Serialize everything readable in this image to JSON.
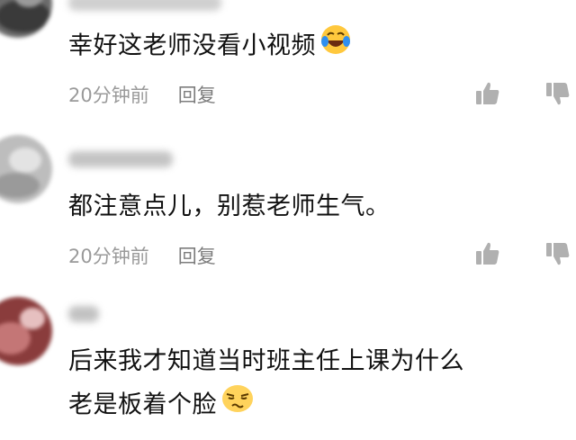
{
  "comments": [
    {
      "text": "幸好这老师没看小视频",
      "emoji": "laugh-cry-emoji",
      "time": "20分钟前",
      "reply_label": "回复",
      "avatar_colors": [
        "#4a4a4a",
        "#8c8c8c",
        "#d0d0d0"
      ],
      "username_color": "#c9c9c9"
    },
    {
      "text": "都注意点儿，别惹老师生气。",
      "time": "20分钟前",
      "reply_label": "回复",
      "avatar_colors": [
        "#a3a3a3",
        "#cdcdcd",
        "#e8e8e8"
      ],
      "username_color": "#bdbdbd"
    },
    {
      "text_lines": [
        "后来我才知道当时班主任上课为什么",
        "老是板着个脸"
      ],
      "emoji": "unamused-emoji",
      "avatar_colors": [
        "#5b2a2a",
        "#a14848",
        "#d9a0a0"
      ],
      "username_color": "#b5b5b5"
    }
  ],
  "icons": {
    "like": "thumb-up-icon",
    "dislike": "thumb-down-icon",
    "color": "#b0b0b0"
  }
}
